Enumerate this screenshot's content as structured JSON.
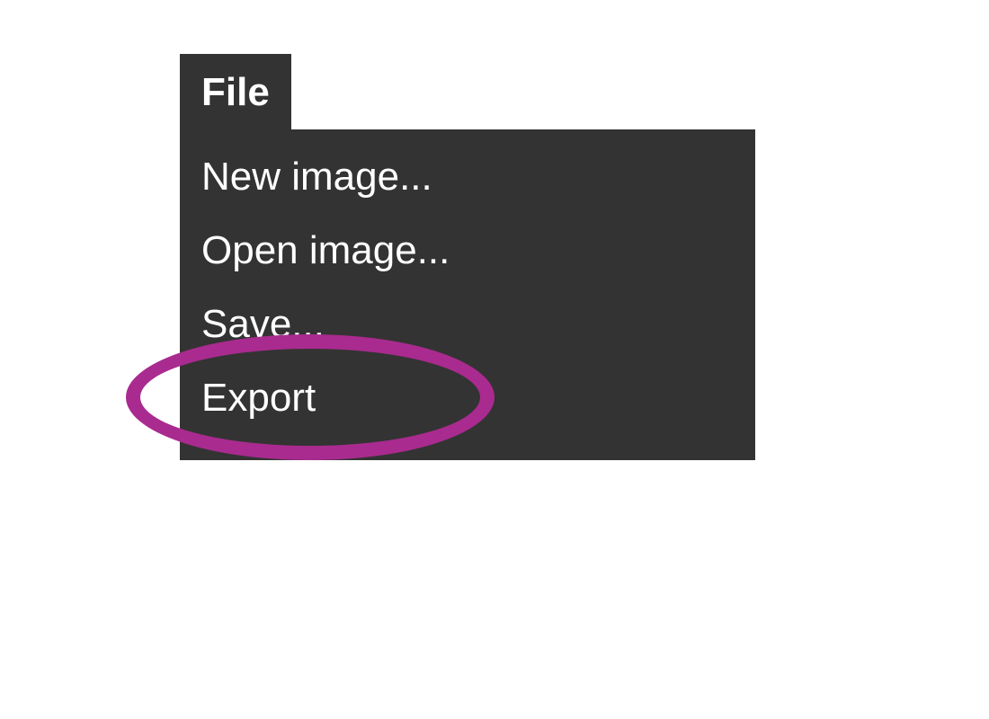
{
  "menu": {
    "header": "File",
    "items": [
      {
        "label": "New image..."
      },
      {
        "label": "Open image..."
      },
      {
        "label": "Save..."
      },
      {
        "label": "Export"
      }
    ]
  },
  "annotation": {
    "highlight_color": "#a92b8f",
    "highlighted_item_index": 2
  }
}
